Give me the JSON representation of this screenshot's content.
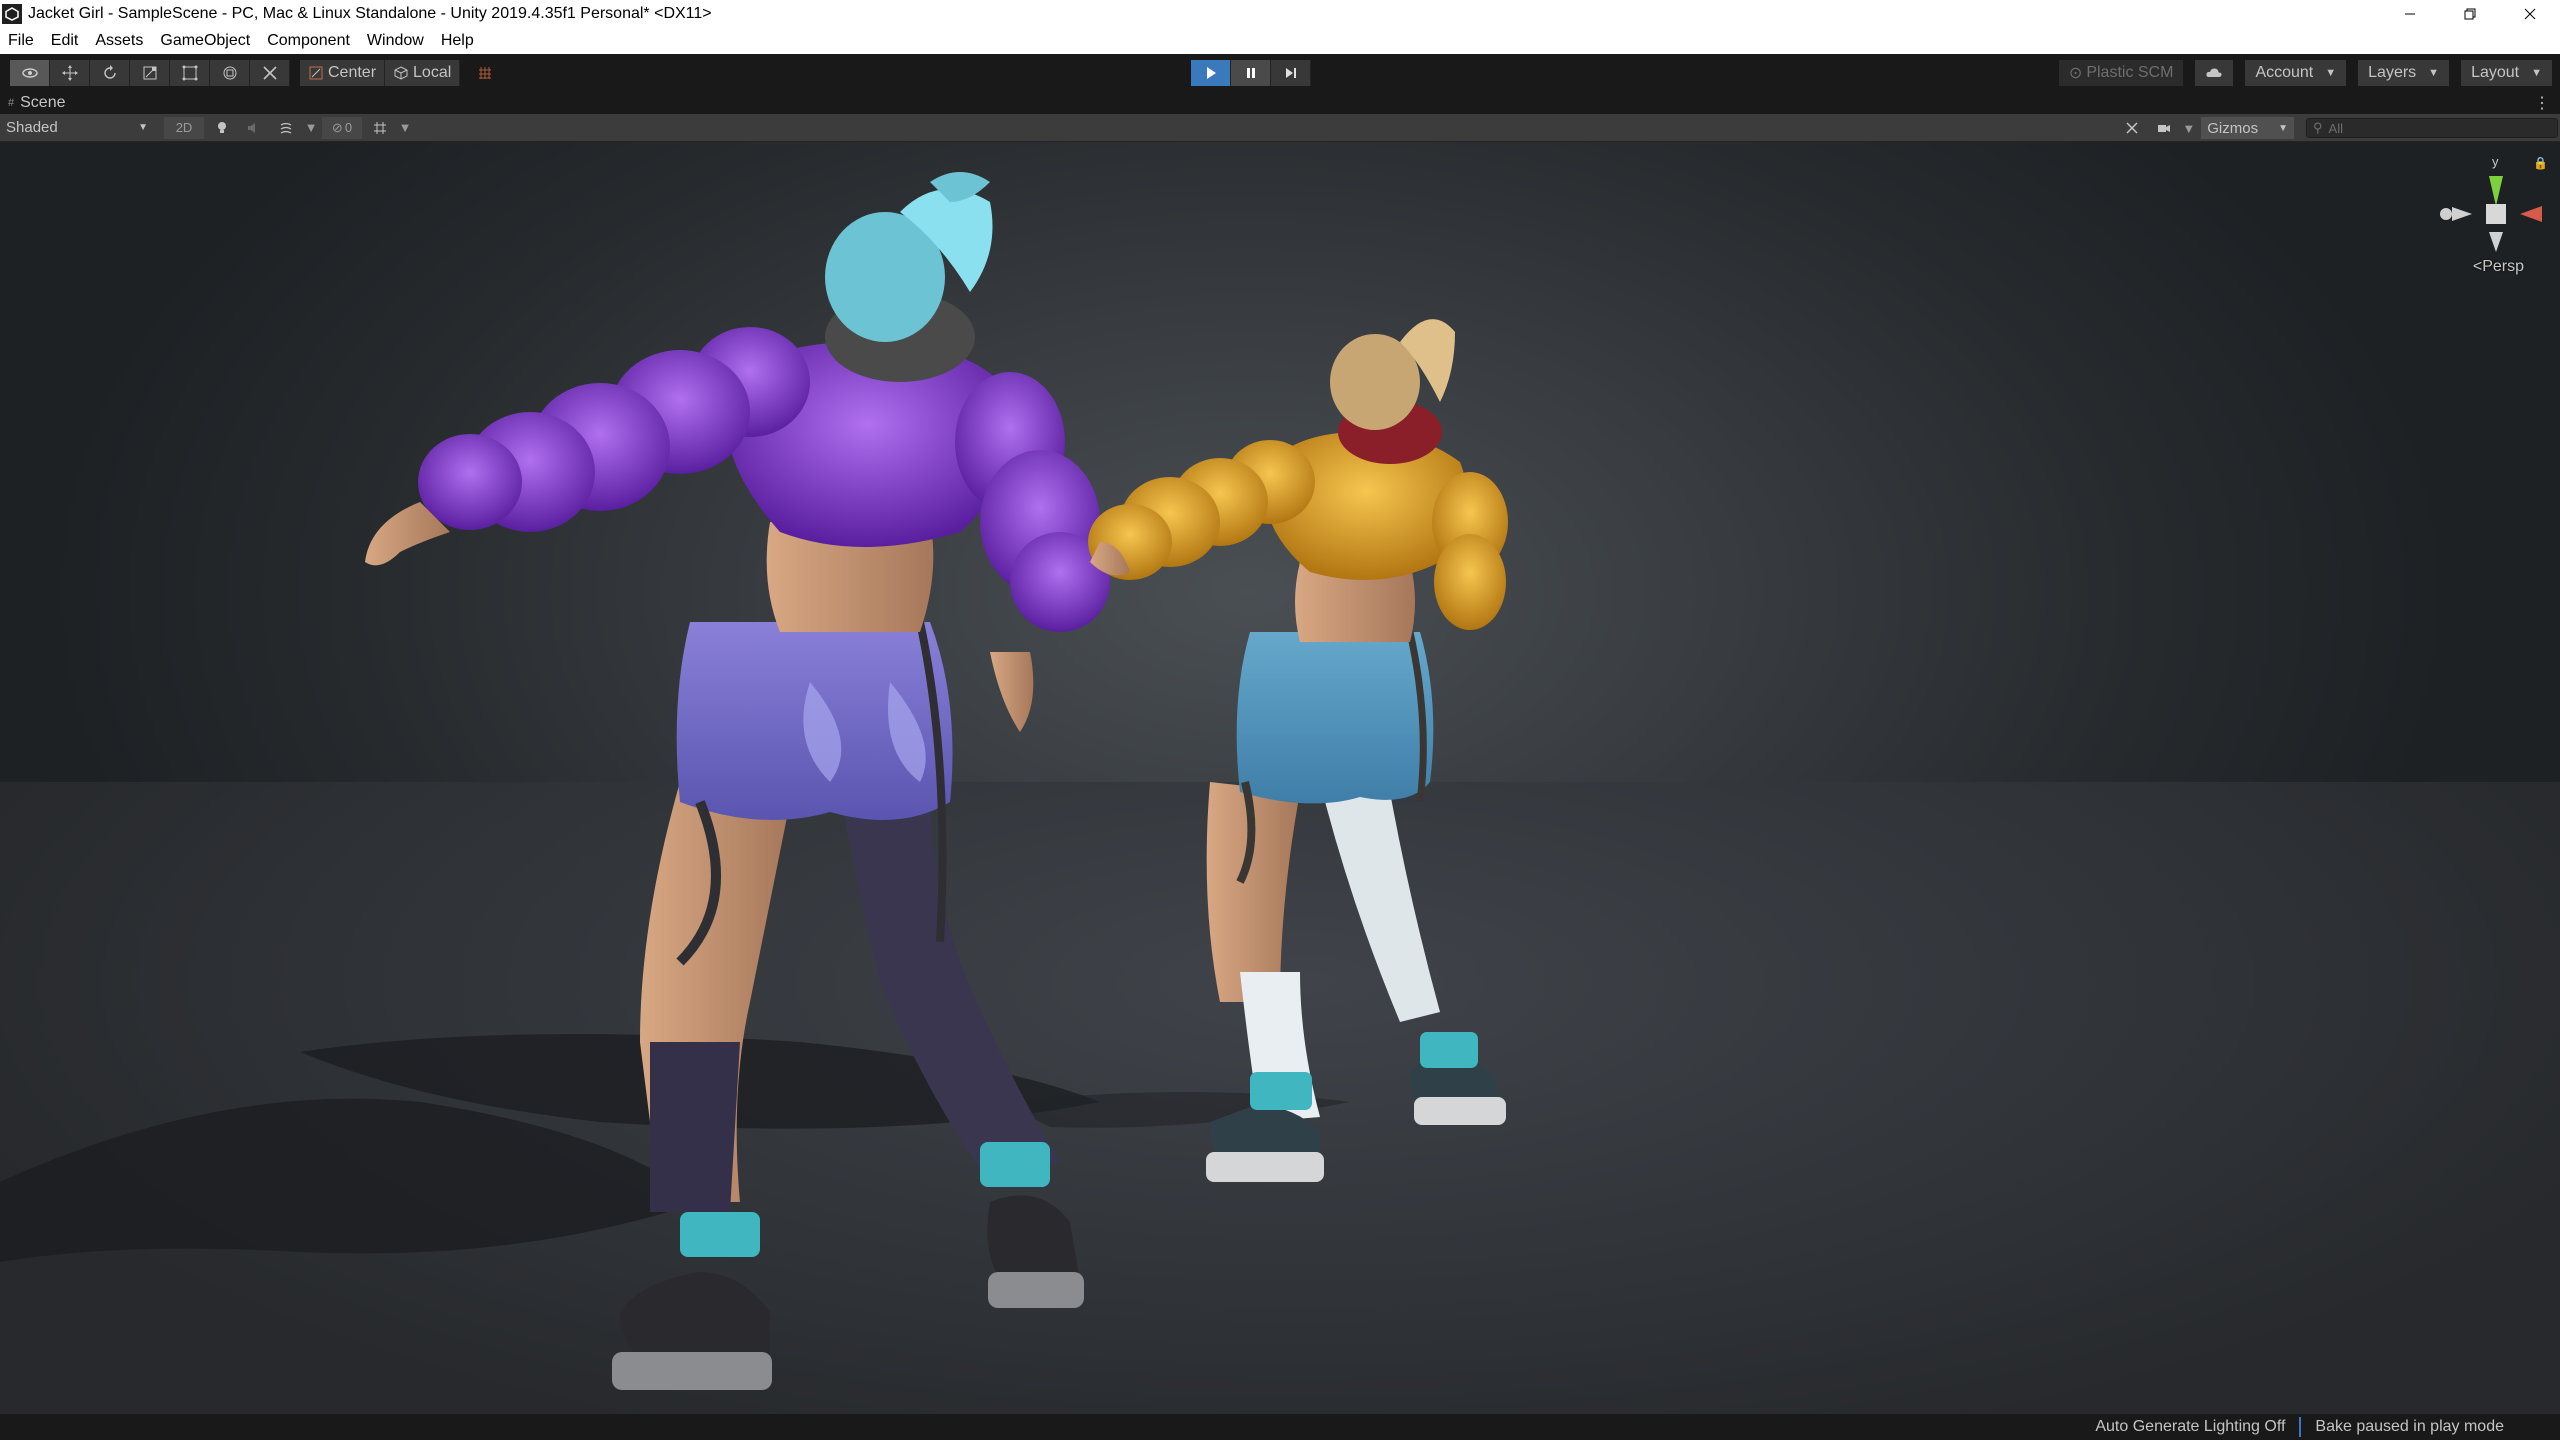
{
  "window": {
    "title": "Jacket Girl - SampleScene - PC, Mac & Linux Standalone - Unity 2019.4.35f1 Personal* <DX11>"
  },
  "menu": [
    "File",
    "Edit",
    "Assets",
    "GameObject",
    "Component",
    "Window",
    "Help"
  ],
  "toolbar": {
    "tools": [
      "view-tool",
      "move-tool",
      "rotate-tool",
      "scale-tool",
      "rect-tool",
      "transform-tool",
      "custom-tool"
    ],
    "pivot_mode": "Center",
    "pivot_rotation": "Local",
    "plastic_scm": "Plastic SCM",
    "account": "Account",
    "layers": "Layers",
    "layout": "Layout"
  },
  "play": {
    "playing": true,
    "paused": true
  },
  "tab": {
    "label": "Scene",
    "menu_glyph": "⋮"
  },
  "scene": {
    "draw_mode": "Shaded",
    "two_d": "2D",
    "hidden_count": "0",
    "gizmos": "Gizmos",
    "search_placeholder": "All",
    "axis_label": "y",
    "projection": "Persp"
  },
  "status": {
    "lighting": "Auto Generate Lighting Off",
    "bake": "Bake paused in play mode"
  },
  "colors": {
    "play_active": "#3a79bb",
    "jacket_purple": "#8a3fcf",
    "jacket_yellow": "#e0a52a",
    "hair_cyan": "#7fd8e6"
  }
}
